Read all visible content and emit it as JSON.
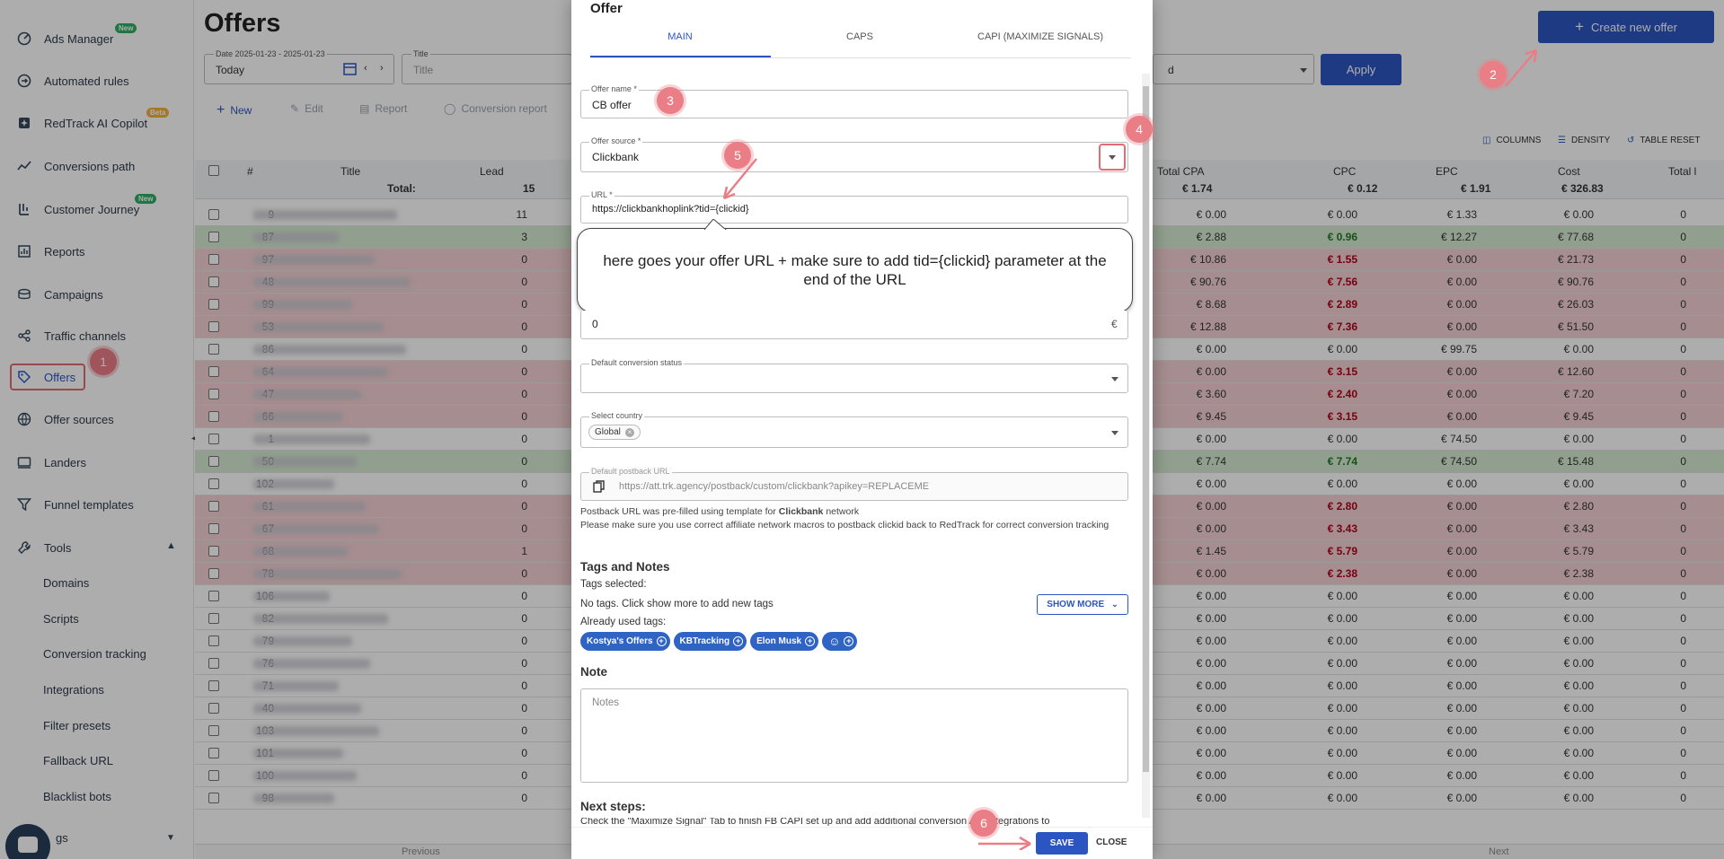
{
  "sidebar": {
    "items": [
      {
        "label": "Ads Manager",
        "icon": "ads-manager-icon",
        "badge": "New"
      },
      {
        "label": "Automated rules",
        "icon": "automated-rules-icon"
      },
      {
        "label": "RedTrack AI Copilot",
        "icon": "copilot-icon",
        "badge": "Beta"
      },
      {
        "label": "Conversions path",
        "icon": "conversions-path-icon"
      },
      {
        "label": "Customer Journey",
        "icon": "customer-journey-icon",
        "badge": "New"
      },
      {
        "label": "Reports",
        "icon": "reports-icon"
      },
      {
        "label": "Campaigns",
        "icon": "campaigns-icon"
      },
      {
        "label": "Traffic channels",
        "icon": "traffic-channels-icon"
      },
      {
        "label": "Offers",
        "icon": "offers-icon"
      },
      {
        "label": "Offer sources",
        "icon": "offer-sources-icon"
      },
      {
        "label": "Landers",
        "icon": "landers-icon"
      },
      {
        "label": "Funnel templates",
        "icon": "funnel-icon"
      },
      {
        "label": "Tools",
        "icon": "tools-icon"
      }
    ],
    "tools_sub": [
      "Domains",
      "Scripts",
      "Conversion tracking",
      "Integrations",
      "Filter presets",
      "Fallback URL",
      "Blacklist bots"
    ],
    "bottom_partial": "gs"
  },
  "header": {
    "title": "Offers",
    "create_button": "Create new offer",
    "date_label": "Date 2025-01-23 - 2025-01-23",
    "date_value": "Today",
    "title_filter_label": "Title",
    "title_filter_placeholder": "Title",
    "filter_value_partial": "d",
    "apply": "Apply"
  },
  "toolbar": {
    "new": "New",
    "edit": "Edit",
    "report": "Report",
    "conversion_report": "Conversion report",
    "columns": "COLUMNS",
    "density": "DENSITY",
    "table_reset": "TABLE RESET"
  },
  "table": {
    "headers": {
      "id": "#",
      "title": "Title",
      "lead": "Lead",
      "total": "Total:",
      "lead_total": "15",
      "total_cpa": "Total CPA",
      "cpc": "CPC",
      "epc": "EPC",
      "cost": "Cost",
      "total_l": "Total l"
    },
    "totals": {
      "total_cpa": "€ 1.74",
      "cpc": "€ 0.12",
      "epc": "€ 1.91",
      "cost": "€ 326.83"
    },
    "rows": [
      {
        "id": "9",
        "lead": "11",
        "zero": "0",
        "cpa": "€ 0.00",
        "cpc": "€ 0.00",
        "epc": "€ 1.33",
        "cost": "€ 0.00",
        "tone": "white",
        "cpc_style": ""
      },
      {
        "id": "87",
        "lead": "3",
        "zero": "0",
        "cpa": "€ 2.88",
        "cpc": "€ 0.96",
        "epc": "€ 12.27",
        "cost": "€ 77.68",
        "tone": "green",
        "cpc_style": "green"
      },
      {
        "id": "97",
        "lead": "0",
        "zero": "0",
        "cpa": "€ 10.86",
        "cpc": "€ 1.55",
        "epc": "€ 0.00",
        "cost": "€ 21.73",
        "tone": "red",
        "cpc_style": "red"
      },
      {
        "id": "48",
        "lead": "0",
        "zero": "0",
        "cpa": "€ 90.76",
        "cpc": "€ 7.56",
        "epc": "€ 0.00",
        "cost": "€ 90.76",
        "tone": "red",
        "cpc_style": "red"
      },
      {
        "id": "99",
        "lead": "0",
        "zero": "0",
        "cpa": "€ 8.68",
        "cpc": "€ 2.89",
        "epc": "€ 0.00",
        "cost": "€ 26.03",
        "tone": "red",
        "cpc_style": "red"
      },
      {
        "id": "53",
        "lead": "0",
        "zero": "0",
        "cpa": "€ 12.88",
        "cpc": "€ 7.36",
        "epc": "€ 0.00",
        "cost": "€ 51.50",
        "tone": "red",
        "cpc_style": "red"
      },
      {
        "id": "86",
        "lead": "0",
        "zero": "0",
        "cpa": "€ 0.00",
        "cpc": "€ 0.00",
        "epc": "€ 99.75",
        "cost": "€ 0.00",
        "tone": "white",
        "cpc_style": ""
      },
      {
        "id": "64",
        "lead": "0",
        "zero": "0",
        "cpa": "€ 0.00",
        "cpc": "€ 3.15",
        "epc": "€ 0.00",
        "cost": "€ 12.60",
        "tone": "red",
        "cpc_style": "red"
      },
      {
        "id": "47",
        "lead": "0",
        "zero": "0",
        "cpa": "€ 3.60",
        "cpc": "€ 2.40",
        "epc": "€ 0.00",
        "cost": "€ 7.20",
        "tone": "red",
        "cpc_style": "red"
      },
      {
        "id": "66",
        "lead": "0",
        "zero": "0",
        "cpa": "€ 9.45",
        "cpc": "€ 3.15",
        "epc": "€ 0.00",
        "cost": "€ 9.45",
        "tone": "red",
        "cpc_style": "red"
      },
      {
        "id": "1",
        "lead": "0",
        "zero": "0",
        "cpa": "€ 0.00",
        "cpc": "€ 0.00",
        "epc": "€ 74.50",
        "cost": "€ 0.00",
        "tone": "white",
        "cpc_style": ""
      },
      {
        "id": "50",
        "lead": "0",
        "zero": "0",
        "cpa": "€ 7.74",
        "cpc": "€ 7.74",
        "epc": "€ 74.50",
        "cost": "€ 15.48",
        "tone": "green",
        "cpc_style": "green"
      },
      {
        "id": "102",
        "lead": "0",
        "zero": "0",
        "cpa": "€ 0.00",
        "cpc": "€ 0.00",
        "epc": "€ 0.00",
        "cost": "€ 0.00",
        "tone": "white",
        "cpc_style": ""
      },
      {
        "id": "61",
        "lead": "0",
        "zero": "0",
        "cpa": "€ 0.00",
        "cpc": "€ 2.80",
        "epc": "€ 0.00",
        "cost": "€ 2.80",
        "tone": "red",
        "cpc_style": "red"
      },
      {
        "id": "67",
        "lead": "0",
        "zero": "0",
        "cpa": "€ 0.00",
        "cpc": "€ 3.43",
        "epc": "€ 0.00",
        "cost": "€ 3.43",
        "tone": "red",
        "cpc_style": "red"
      },
      {
        "id": "68",
        "lead": "1",
        "zero": "0",
        "cpa": "€ 1.45",
        "cpc": "€ 5.79",
        "epc": "€ 0.00",
        "cost": "€ 5.79",
        "tone": "red",
        "cpc_style": "red"
      },
      {
        "id": "78",
        "lead": "0",
        "zero": "0",
        "cpa": "€ 0.00",
        "cpc": "€ 2.38",
        "epc": "€ 0.00",
        "cost": "€ 2.38",
        "tone": "red",
        "cpc_style": "red"
      },
      {
        "id": "106",
        "lead": "0",
        "zero": "0",
        "cpa": "€ 0.00",
        "cpc": "€ 0.00",
        "epc": "€ 0.00",
        "cost": "€ 0.00",
        "tone": "white",
        "cpc_style": ""
      },
      {
        "id": "82",
        "lead": "0",
        "zero": "0",
        "cpa": "€ 0.00",
        "cpc": "€ 0.00",
        "epc": "€ 0.00",
        "cost": "€ 0.00",
        "tone": "white",
        "cpc_style": ""
      },
      {
        "id": "79",
        "lead": "0",
        "zero": "0",
        "cpa": "€ 0.00",
        "cpc": "€ 0.00",
        "epc": "€ 0.00",
        "cost": "€ 0.00",
        "tone": "white",
        "cpc_style": ""
      },
      {
        "id": "76",
        "lead": "0",
        "zero": "0",
        "cpa": "€ 0.00",
        "cpc": "€ 0.00",
        "epc": "€ 0.00",
        "cost": "€ 0.00",
        "tone": "white",
        "cpc_style": ""
      },
      {
        "id": "71",
        "lead": "0",
        "zero": "0",
        "cpa": "€ 0.00",
        "cpc": "€ 0.00",
        "epc": "€ 0.00",
        "cost": "€ 0.00",
        "tone": "white",
        "cpc_style": ""
      },
      {
        "id": "40",
        "lead": "0",
        "zero": "0",
        "cpa": "€ 0.00",
        "cpc": "€ 0.00",
        "epc": "€ 0.00",
        "cost": "€ 0.00",
        "tone": "white",
        "cpc_style": ""
      },
      {
        "id": "103",
        "lead": "0",
        "zero": "0",
        "cpa": "€ 0.00",
        "cpc": "€ 0.00",
        "epc": "€ 0.00",
        "cost": "€ 0.00",
        "tone": "white",
        "cpc_style": ""
      },
      {
        "id": "101",
        "lead": "0",
        "zero": "0",
        "cpa": "€ 0.00",
        "cpc": "€ 0.00",
        "epc": "€ 0.00",
        "cost": "€ 0.00",
        "tone": "white",
        "cpc_style": ""
      },
      {
        "id": "100",
        "lead": "0",
        "zero": "0",
        "cpa": "€ 0.00",
        "cpc": "€ 0.00",
        "epc": "€ 0.00",
        "cost": "€ 0.00",
        "tone": "white",
        "cpc_style": ""
      },
      {
        "id": "98",
        "lead": "0",
        "zero": "0",
        "cpa": "€ 0.00",
        "cpc": "€ 0.00",
        "epc": "€ 0.00",
        "cost": "€ 0.00",
        "tone": "white",
        "cpc_style": ""
      }
    ],
    "pagination": {
      "previous": "Previous",
      "next": "Next"
    }
  },
  "modal": {
    "title": "Offer",
    "tabs": [
      "MAIN",
      "CAPS",
      "CAPI (MAXIMIZE SIGNALS)"
    ],
    "offer_name_label": "Offer name *",
    "offer_name_value": "CB offer",
    "offer_source_label": "Offer source *",
    "offer_source_value": "Clickbank",
    "url_label": "URL *",
    "url_value": "https://clickbankhoplink?tid={clickid}",
    "callout": "here goes your offer URL + make sure to add tid={clickid} parameter at the end of the URL",
    "payout_value": "0",
    "currency": "€",
    "conv_status_label": "Default conversion status",
    "country_label": "Select country",
    "country_chip": "Global",
    "postback_label": "Default postback URL",
    "postback_value": "https://att.trk.agency/postback/custom/clickbank?apikey=REPLACEME",
    "postback_note_prefix": "Postback URL was pre-filled using template for ",
    "postback_note_network": "Clickbank",
    "postback_note_suffix": " network",
    "postback_note2": "Please make sure you use correct affiliate network macros to postback clickid back to RedTrack for correct conversion tracking",
    "tags_heading": "Tags and Notes",
    "tags_selected": "Tags selected:",
    "no_tags": "No tags. Click show more to add new tags",
    "show_more": "SHOW MORE",
    "already_used": "Already used tags:",
    "tags": [
      "Kostya's Offers",
      "KBTracking",
      "Elon Musk"
    ],
    "note_heading": "Note",
    "note_placeholder": "Notes",
    "next_steps_heading": "Next steps:",
    "next_steps_text": "Check the \"Maximize Signal\" Tab to finish FB CAPI set up and add additional conversion API integrations to",
    "save": "SAVE",
    "close": "CLOSE"
  },
  "steps": [
    "1",
    "2",
    "3",
    "4",
    "5",
    "6"
  ],
  "colors": {
    "accent": "#2b56c2",
    "step": "#ea7e86",
    "red_row": "#f5d0d3",
    "green_row": "#d6ebd1"
  }
}
